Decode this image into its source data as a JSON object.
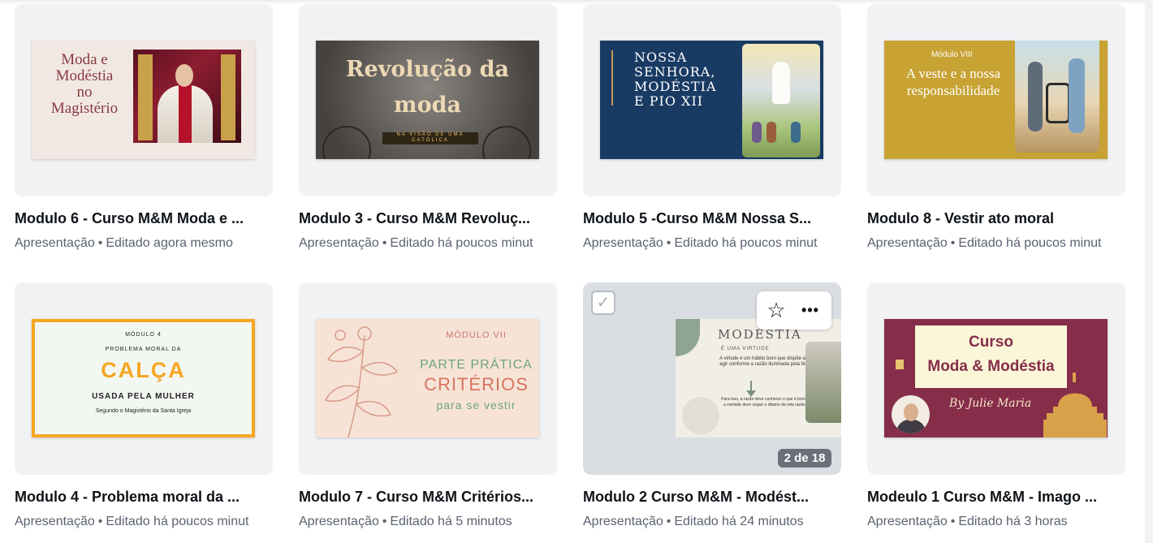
{
  "cards": [
    {
      "title": "Modulo 6 - Curso M&M  Moda e ...",
      "type": "Apresentação",
      "edited": "Editado agora mesmo",
      "slide": {
        "text": "Moda e\nModéstia\nno\nMagistério"
      }
    },
    {
      "title": "Modulo 3 - Curso M&M Revoluç...",
      "type": "Apresentação",
      "edited": "Editado há poucos minut",
      "slide": {
        "title": "Revolução da\nmoda",
        "subtitle": "NA VISÃO DE UMA CATÓLICA"
      }
    },
    {
      "title": "Modulo 5 -Curso M&M Nossa S...",
      "type": "Apresentação",
      "edited": "Editado há poucos minut",
      "slide": {
        "text": "NOSSA\nSENHORA,\nMODÉSTIA\nE PIO XII"
      }
    },
    {
      "title": "Modulo 8 - Vestir ato moral",
      "type": "Apresentação",
      "edited": "Editado há poucos minut",
      "slide": {
        "label": "Módulo VIII",
        "text": "A veste e a nossa\nresponsabilidade"
      }
    },
    {
      "title": "Modulo 4 - Problema moral da ...",
      "type": "Apresentação",
      "edited": "Editado há poucos minut",
      "slide": {
        "line1": "MÓDULO 4",
        "line2": "PROBLEMA MORAL DA",
        "line3": "CALÇA",
        "line4": "USADA PELA MULHER",
        "line5": "Segundo o Magistério da Santa Igreja"
      }
    },
    {
      "title": "Modulo 7 - Curso M&M Critérios...",
      "type": "Apresentação",
      "edited": "Editado há 5 minutos",
      "slide": {
        "label": "MÓDULO VII",
        "line1": "PARTE PRÁTICA",
        "line2": "CRITÉRIOS",
        "line3": "para se vestir"
      }
    },
    {
      "title": "Modulo 2 Curso M&M  - Modést...",
      "type": "Apresentação",
      "edited": "Editado há 24 minutos",
      "page_badge": "2 de 18",
      "slide": {
        "title": "MODÉSTIA",
        "subtitle": "É UMA VIRTUDE",
        "body1": "A virtude é um hábito bom que dispõe a agir conforme a razão iluminada pela fé",
        "body2": "Para isso, a razão deve conhecer o que é bom e a vontade deve seguir o ditame da reta razão!"
      }
    },
    {
      "title": "Modeulo  1 Curso M&M - Imago ...",
      "type": "Apresentação",
      "edited": "Editado há 3 horas",
      "slide": {
        "line1": "Curso",
        "line2": "Moda & Modéstia",
        "by": "By Julie Maria"
      }
    }
  ],
  "separator": "•",
  "icons": {
    "checkbox": "checkbox-icon",
    "star": "star-icon",
    "more": "more-icon"
  },
  "glyphs": {
    "check": "✓",
    "star": "☆",
    "more": "•••"
  }
}
